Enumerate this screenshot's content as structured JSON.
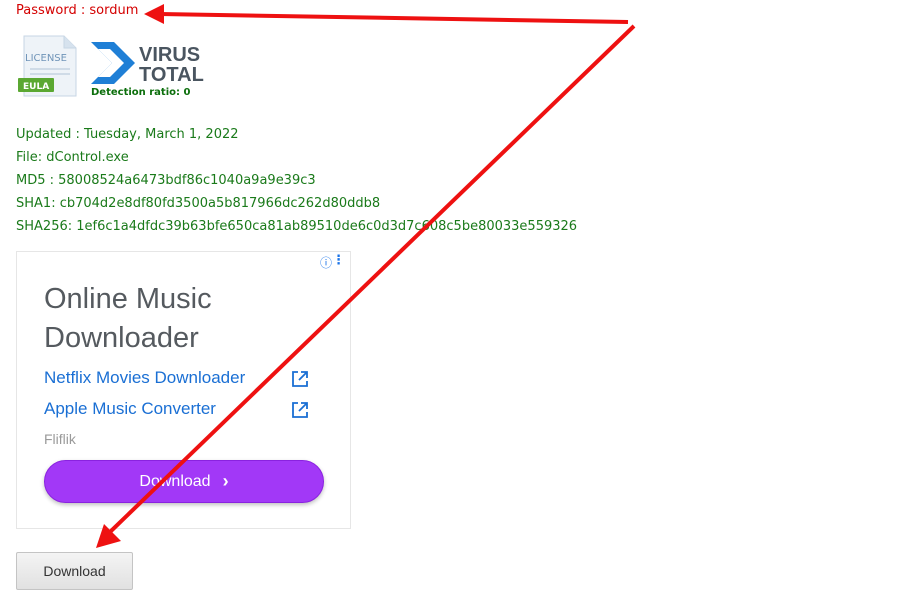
{
  "password_line": "Password : sordum",
  "eula_icon": {
    "top_text": "LICENSE",
    "badge": "EULA"
  },
  "virustotal": {
    "line1": "VIRUS",
    "line2": "TOTAL",
    "detection": "Detection ratio:  0"
  },
  "file_info": {
    "updated": "Updated : Tuesday, March 1, 2022",
    "file": "File: dControl.exe",
    "md5": "MD5 : 58008524a6473bdf86c1040a9a9e39c3",
    "sha1": "SHA1: cb704d2e8df80fd3500a5b817966dc262d80ddb8",
    "sha256": "SHA256: 1ef6c1a4dfdc39b63bfe650ca81ab89510de6c0d3d7c608c5be80033e559326"
  },
  "ad": {
    "title": "Online Music Downloader",
    "links": [
      "Netflix Movies Downloader",
      "Apple Music Converter"
    ],
    "advertiser": "Fliflik",
    "cta_label": "Download",
    "info_icon": "info-icon",
    "menu_icon": "more-vert-icon"
  },
  "download_button": "Download",
  "colors": {
    "password": "#d40000",
    "info_text": "#1a7a1a",
    "ad_cta": "#a238f7",
    "arrow": "#ee1111"
  }
}
